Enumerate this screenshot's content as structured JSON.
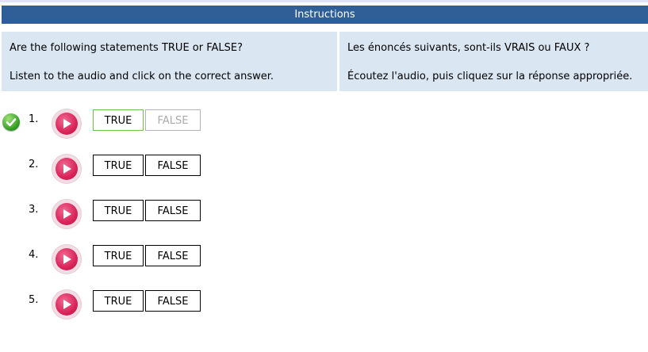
{
  "header": {
    "title": "Instructions"
  },
  "instructions": {
    "en": {
      "line1": "Are the following statements TRUE or FALSE?",
      "line2": "Listen to the audio and click on the correct answer."
    },
    "fr": {
      "line1": "Les énoncés suivants, sont-ils VRAIS ou FAUX ?",
      "line2": "Écoutez l'audio, puis cliquez sur la réponse appropriée."
    }
  },
  "questions": [
    {
      "number": "1.",
      "true_label": "TRUE",
      "false_label": "FALSE",
      "answered": true,
      "selected": "TRUE"
    },
    {
      "number": "2.",
      "true_label": "TRUE",
      "false_label": "FALSE",
      "answered": false
    },
    {
      "number": "3.",
      "true_label": "TRUE",
      "false_label": "FALSE",
      "answered": false
    },
    {
      "number": "4.",
      "true_label": "TRUE",
      "false_label": "FALSE",
      "answered": false
    },
    {
      "number": "5.",
      "true_label": "TRUE",
      "false_label": "FALSE",
      "answered": false
    }
  ],
  "colors": {
    "header_bg": "#2f5f96",
    "panel_bg": "#dae6f2",
    "correct": "#6cc24a",
    "play": "#d9245a"
  },
  "icons": {
    "correct": "check-circle-icon",
    "play": "play-icon"
  }
}
